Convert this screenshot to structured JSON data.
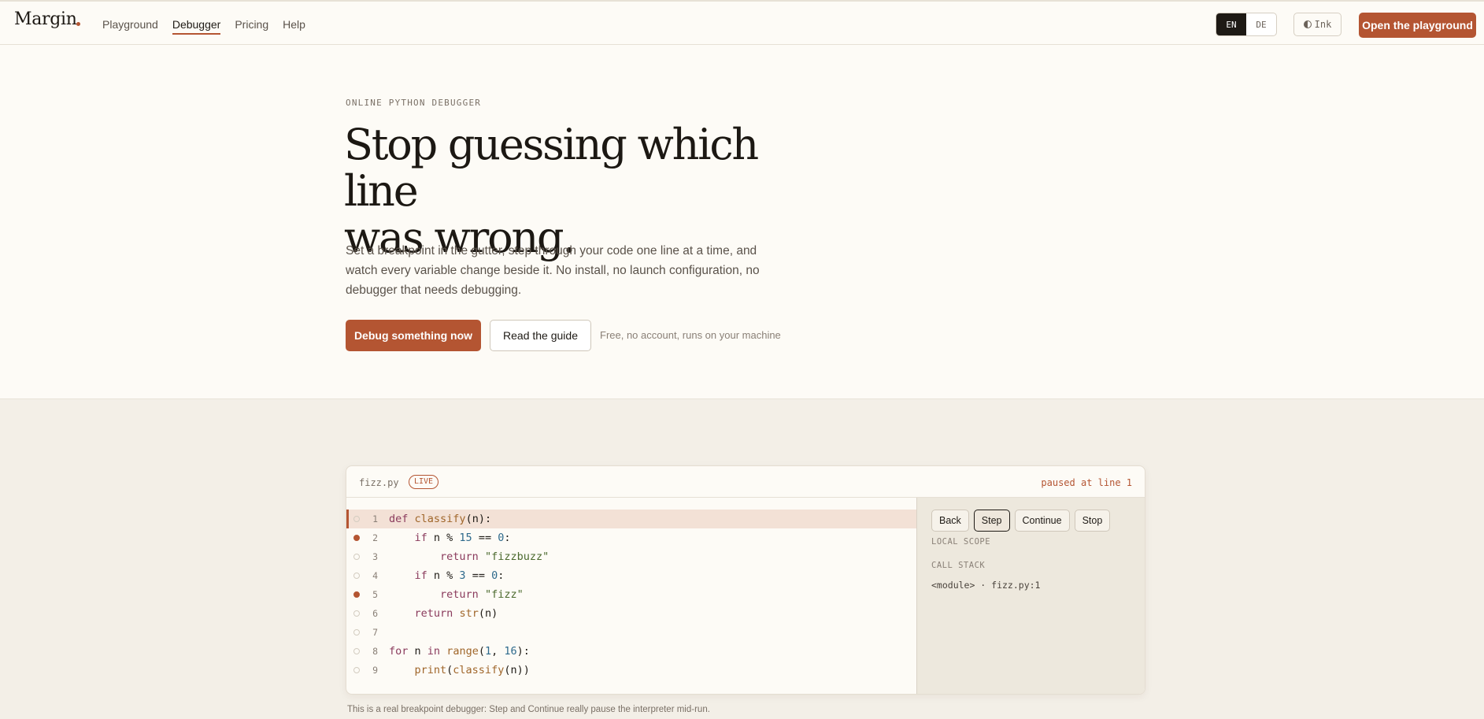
{
  "header": {
    "logo": "Margin",
    "nav": [
      {
        "label": "Playground",
        "active": false
      },
      {
        "label": "Debugger",
        "active": true
      },
      {
        "label": "Pricing",
        "active": false
      },
      {
        "label": "Help",
        "active": false
      }
    ],
    "lang_en": "EN",
    "lang_de": "DE",
    "theme_label": "Ink",
    "theme_icon": "half-circle-icon",
    "cta": "Open the playground"
  },
  "hero": {
    "eyebrow": "ONLINE PYTHON DEBUGGER",
    "title_line1": "Stop guessing which line",
    "title_line2": "was wrong.",
    "lede": "Set a breakpoint in the gutter, step through your code one line at a time, and watch every variable change beside it. No install, no launch configuration, no debugger that needs debugging.",
    "primary_button": "Debug something now",
    "secondary_button": "Read the guide",
    "note": "Free, no account, runs on your machine"
  },
  "debugger": {
    "filename": "fizz.py",
    "live_badge": "LIVE",
    "status": "paused at line 1",
    "code_lines": [
      {
        "num": "1",
        "text": "def classify(n):"
      },
      {
        "num": "2",
        "text": "    if n % 15 == 0:"
      },
      {
        "num": "3",
        "text": "        return \"fizzbuzz\""
      },
      {
        "num": "4",
        "text": "    if n % 3 == 0:"
      },
      {
        "num": "5",
        "text": "        return \"fizz\""
      },
      {
        "num": "6",
        "text": "    return str(n)"
      },
      {
        "num": "7",
        "text": ""
      },
      {
        "num": "8",
        "text": "for n in range(1, 16):"
      },
      {
        "num": "9",
        "text": "    print(classify(n))"
      }
    ],
    "breakpoints": [
      2,
      5
    ],
    "current_line": 1,
    "controls": [
      "Back",
      "Step",
      "Continue",
      "Stop"
    ],
    "active_control": "Step",
    "local_scope_label": "LOCAL SCOPE",
    "call_stack_label": "CALL STACK",
    "call_stack": [
      "<module> · fizz.py:1"
    ]
  },
  "caption": "This is a real breakpoint debugger: Step and Continue really pause the interpreter mid-run.",
  "colors": {
    "accent": "#b45532",
    "background": "#fdfbf6",
    "band": "#f3efe7",
    "current_line": "#f3e1d6"
  }
}
